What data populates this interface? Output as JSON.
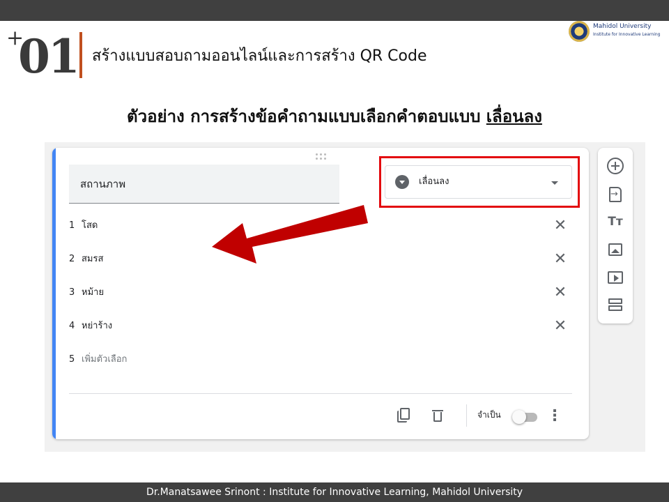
{
  "slide": {
    "number": "01",
    "plus": "+",
    "title": "สร้างแบบสอบถามออนไลน์และการสร้าง  QR Code",
    "subtitle_main": "ตัวอย่าง การสร้างข้อคำถามแบบเลือกคำตอบแบบ ",
    "subtitle_emphasis": "เลื่อนลง",
    "footer": "Dr.Manatsawee  Srinont : Institute for Innovative Learning, Mahidol University"
  },
  "logo": {
    "line1": "Mahidol University",
    "line2": "Institute for Innovative Learning"
  },
  "form": {
    "question_title": "สถานภาพ",
    "question_type": "เลื่อนลง",
    "options": [
      {
        "number": "1",
        "label": "โสด"
      },
      {
        "number": "2",
        "label": "สมรส"
      },
      {
        "number": "3",
        "label": "หม้าย"
      },
      {
        "number": "4",
        "label": "หย่าร้าง"
      }
    ],
    "add_option": {
      "number": "5",
      "label": "เพิ่มตัวเลือก"
    },
    "required_label": "จำเป็น",
    "required": false,
    "remove_icon": "close-icon"
  },
  "colors": {
    "accent": "#4285f4",
    "highlight": "#e3090e",
    "arrow": "#c00000",
    "number_bar": "#c0501f"
  }
}
